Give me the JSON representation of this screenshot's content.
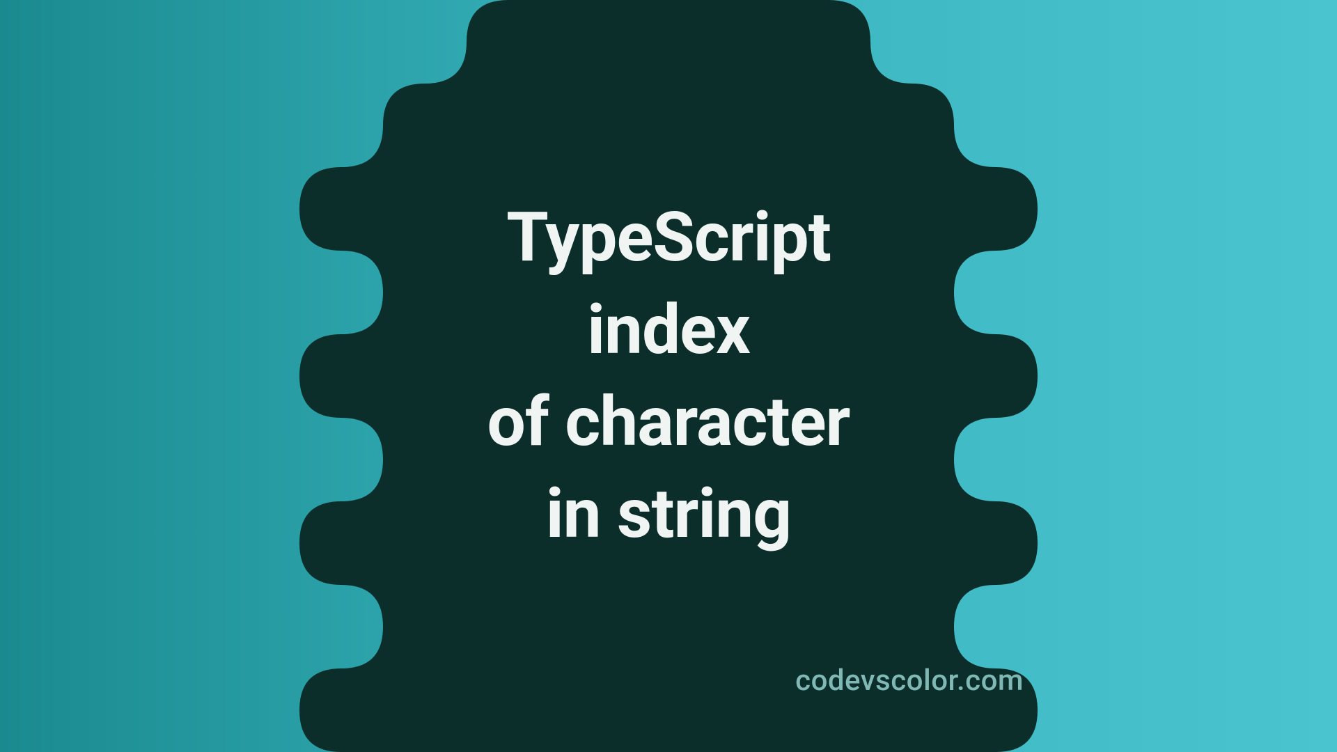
{
  "title": {
    "line1": "TypeScript",
    "line2": "index",
    "line3": "of character",
    "line4": "in string"
  },
  "watermark": "codevscolor.com",
  "colors": {
    "bg_gradient_start": "#1a8a8f",
    "bg_gradient_end": "#4ac4ce",
    "blob": "#0c2e2b",
    "text": "#f0f5f4",
    "watermark": "#7fb8b5"
  }
}
